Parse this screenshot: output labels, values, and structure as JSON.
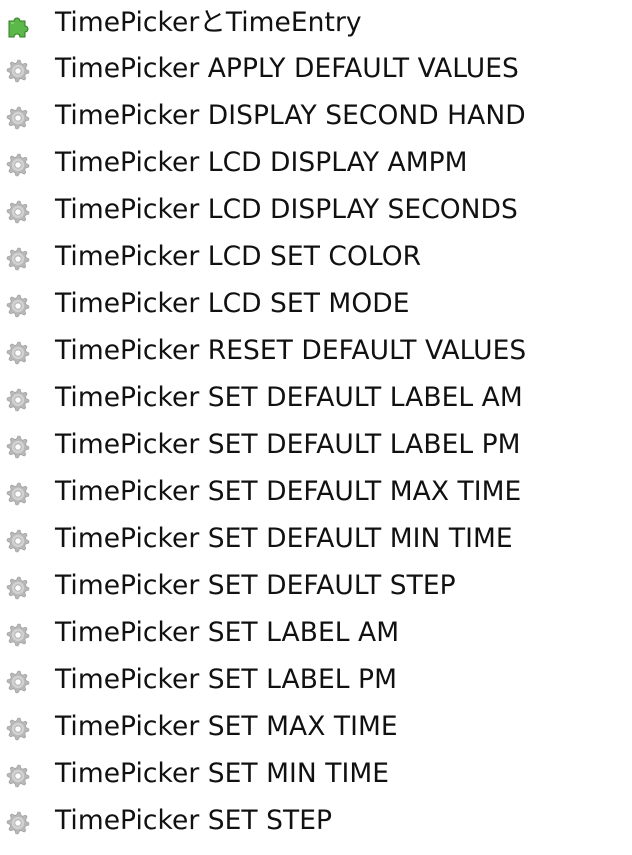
{
  "tree": {
    "items": [
      {
        "label": "TimePickerとTimeEntry",
        "icon": "puzzle-piece-icon",
        "icon_color": "#4caf3a"
      },
      {
        "label": "TimePicker APPLY DEFAULT VALUES",
        "icon": "gear-icon",
        "icon_color": "#b8b8b8"
      },
      {
        "label": "TimePicker DISPLAY SECOND HAND",
        "icon": "gear-icon",
        "icon_color": "#b8b8b8"
      },
      {
        "label": "TimePicker LCD DISPLAY AMPM",
        "icon": "gear-icon",
        "icon_color": "#b8b8b8"
      },
      {
        "label": "TimePicker LCD DISPLAY SECONDS",
        "icon": "gear-icon",
        "icon_color": "#b8b8b8"
      },
      {
        "label": "TimePicker LCD SET COLOR",
        "icon": "gear-icon",
        "icon_color": "#b8b8b8"
      },
      {
        "label": "TimePicker LCD SET MODE",
        "icon": "gear-icon",
        "icon_color": "#b8b8b8"
      },
      {
        "label": "TimePicker RESET DEFAULT VALUES",
        "icon": "gear-icon",
        "icon_color": "#b8b8b8"
      },
      {
        "label": "TimePicker SET DEFAULT LABEL AM",
        "icon": "gear-icon",
        "icon_color": "#b8b8b8"
      },
      {
        "label": "TimePicker SET DEFAULT LABEL PM",
        "icon": "gear-icon",
        "icon_color": "#b8b8b8"
      },
      {
        "label": "TimePicker SET DEFAULT MAX TIME",
        "icon": "gear-icon",
        "icon_color": "#b8b8b8"
      },
      {
        "label": "TimePicker SET DEFAULT MIN TIME",
        "icon": "gear-icon",
        "icon_color": "#b8b8b8"
      },
      {
        "label": "TimePicker SET DEFAULT STEP",
        "icon": "gear-icon",
        "icon_color": "#b8b8b8"
      },
      {
        "label": "TimePicker SET LABEL AM",
        "icon": "gear-icon",
        "icon_color": "#b8b8b8"
      },
      {
        "label": "TimePicker SET LABEL PM",
        "icon": "gear-icon",
        "icon_color": "#b8b8b8"
      },
      {
        "label": "TimePicker SET MAX TIME",
        "icon": "gear-icon",
        "icon_color": "#b8b8b8"
      },
      {
        "label": "TimePicker SET MIN TIME",
        "icon": "gear-icon",
        "icon_color": "#b8b8b8"
      },
      {
        "label": "TimePicker SET STEP",
        "icon": "gear-icon",
        "icon_color": "#b8b8b8"
      }
    ]
  }
}
